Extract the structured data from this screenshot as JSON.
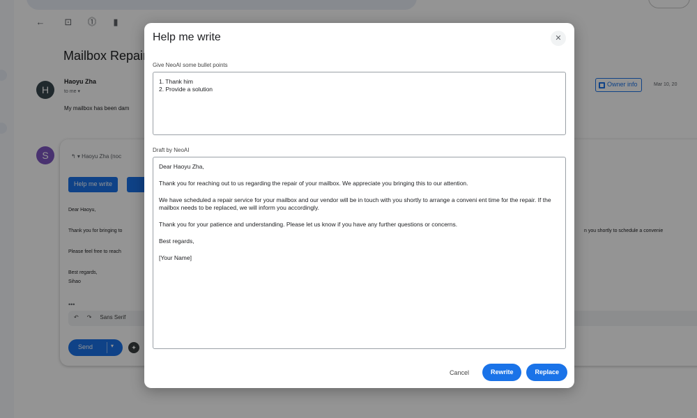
{
  "background": {
    "subject": "Mailbox Repair",
    "sender_initial": "H",
    "sender_name": "Haoyu Zha",
    "to_me": "to me ▾",
    "preview": "My mailbox has been dam",
    "owner_info": "Owner info",
    "date": "Mar 10, 20",
    "reply": {
      "avatar_initial": "S",
      "header": "↰ ▾  Haoyu Zha (noc",
      "help_me_write": "Help me write",
      "lines": [
        "Dear Haoyu,",
        "Thank you for bringing to",
        "Please feel free to reach",
        "Best regards,",
        "Sihao"
      ],
      "right_fragment": "n you shortly to schedule a convenie",
      "ellipsis": "•••",
      "format_font": "Sans Serif",
      "send": "Send"
    }
  },
  "dialog": {
    "title": "Help me write",
    "close_glyph": "✕",
    "bullets_label": "Give NeoAI some bullet points",
    "bullets": [
      "1. Thank him",
      "2. Provide a solution"
    ],
    "draft_label": "Draft by NeoAI",
    "draft": [
      "Dear Haoyu Zha,",
      "Thank you for reaching out to us regarding the repair of your mailbox. We appreciate you bringing this to our attention.",
      "We have scheduled a repair service for your mailbox and our vendor will be in touch with you shortly to arrange a conveni ent time for the repair. If the mailbox needs to be replaced, we will inform you accordingly.",
      "Thank you for your patience and understanding. Please let us know if you have any further questions or concerns.",
      "Best regards,",
      "[Your Name]"
    ],
    "cancel": "Cancel",
    "rewrite": "Rewrite",
    "replace": "Replace"
  }
}
